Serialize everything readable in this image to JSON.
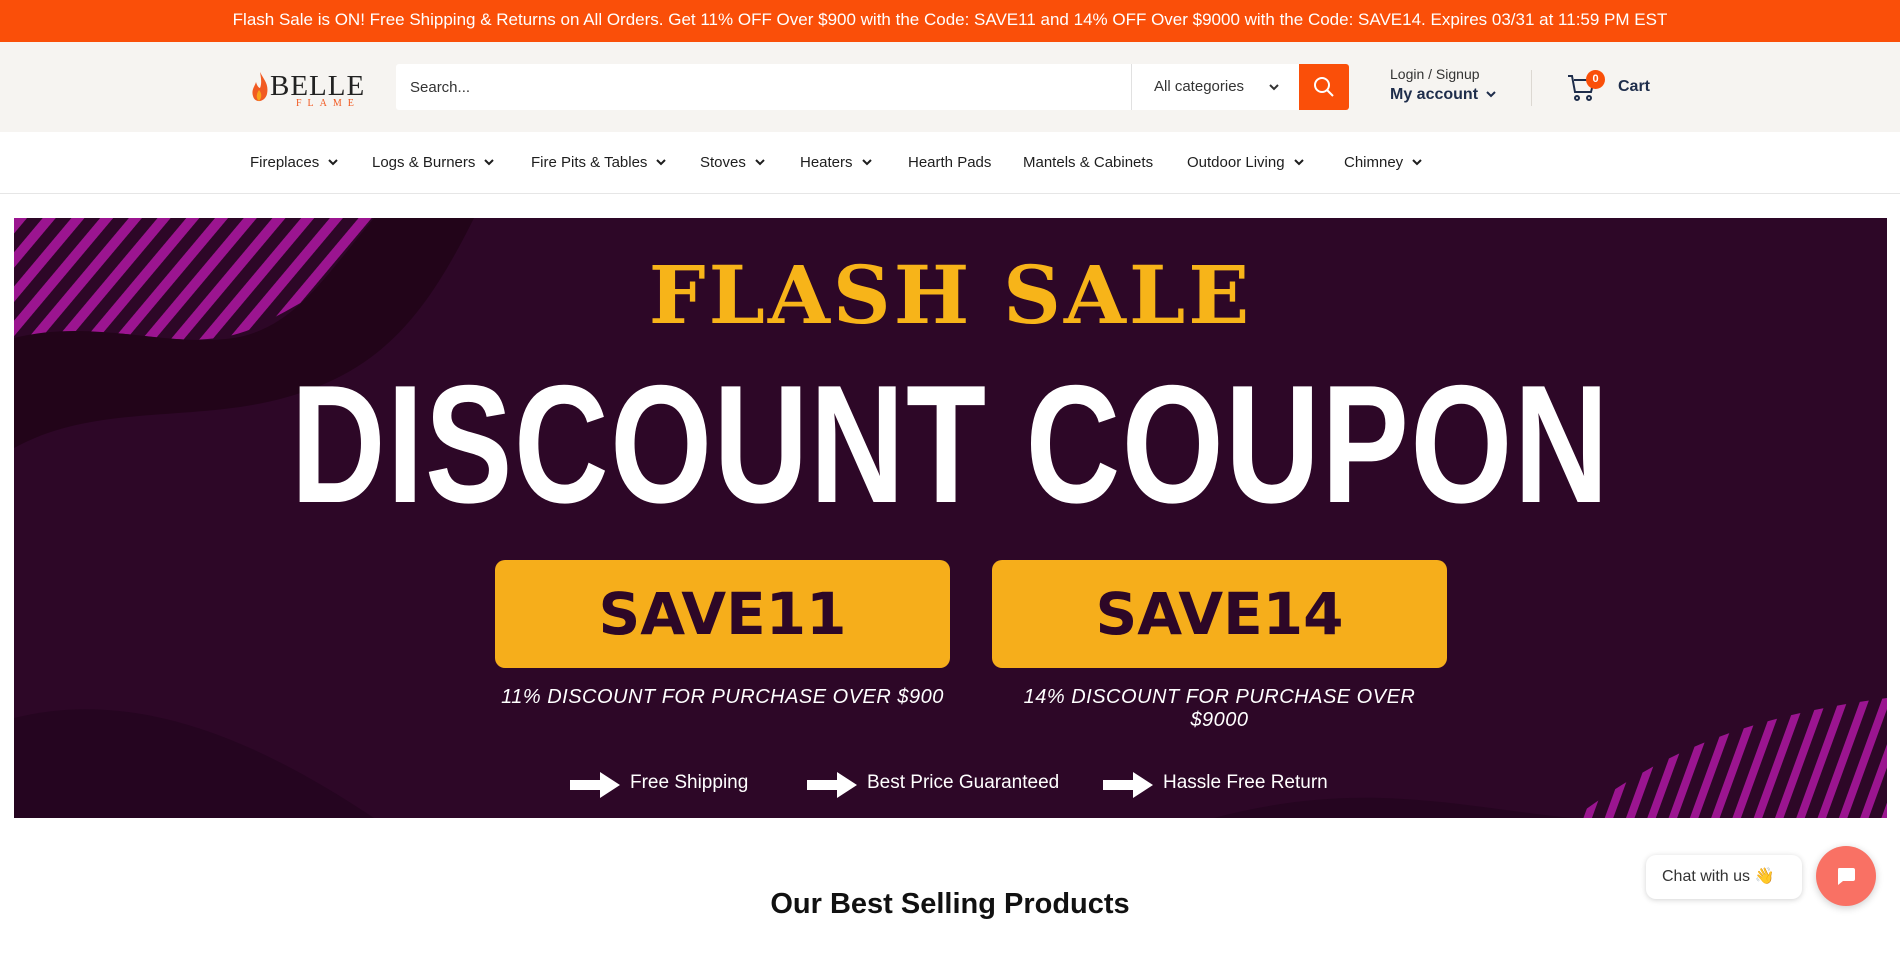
{
  "announcement": "Flash Sale is ON! Free Shipping & Returns on All Orders. Get 11% OFF Over $900 with the Code: SAVE11 and 14% OFF Over $9000 with the Code: SAVE14. Expires 03/31 at 11:59 PM EST",
  "logo": {
    "word": "BELLE",
    "sub": "FLAME"
  },
  "search": {
    "placeholder": "Search...",
    "category": "All categories"
  },
  "account": {
    "line1": "Login / Signup",
    "line2": "My account"
  },
  "cart": {
    "count": "0",
    "label": "Cart"
  },
  "nav": [
    {
      "label": "Fireplaces",
      "dropdown": true
    },
    {
      "label": "Logs & Burners",
      "dropdown": true
    },
    {
      "label": "Fire Pits & Tables",
      "dropdown": true
    },
    {
      "label": "Stoves",
      "dropdown": true
    },
    {
      "label": "Heaters",
      "dropdown": true
    },
    {
      "label": "Hearth Pads",
      "dropdown": false
    },
    {
      "label": "Mantels & Cabinets",
      "dropdown": false
    },
    {
      "label": "Outdoor Living",
      "dropdown": true
    },
    {
      "label": "Chimney",
      "dropdown": true
    }
  ],
  "banner": {
    "flash_title": "FLASH SALE",
    "main_title": "DISCOUNT COUPON",
    "codes": [
      {
        "code": "SAVE11",
        "desc": "11% DISCOUNT FOR PURCHASE OVER $900"
      },
      {
        "code": "SAVE14",
        "desc": "14% DISCOUNT FOR PURCHASE OVER $9000"
      }
    ],
    "features": [
      "Free Shipping",
      "Best Price Guaranteed",
      "Hassle Free Return"
    ]
  },
  "section_title": "Our Best Selling Products",
  "chat": {
    "label": "Chat with us 👋"
  },
  "colors": {
    "brand": "#fa4f09",
    "banner_bg": "#2d0727",
    "accent_yellow": "#f6ae1b",
    "stripe": "#9b1590"
  },
  "icons": [
    "flame-logo-icon",
    "chevron-down-icon",
    "search-icon",
    "cart-icon",
    "arrow-right-icon",
    "chat-icon"
  ]
}
